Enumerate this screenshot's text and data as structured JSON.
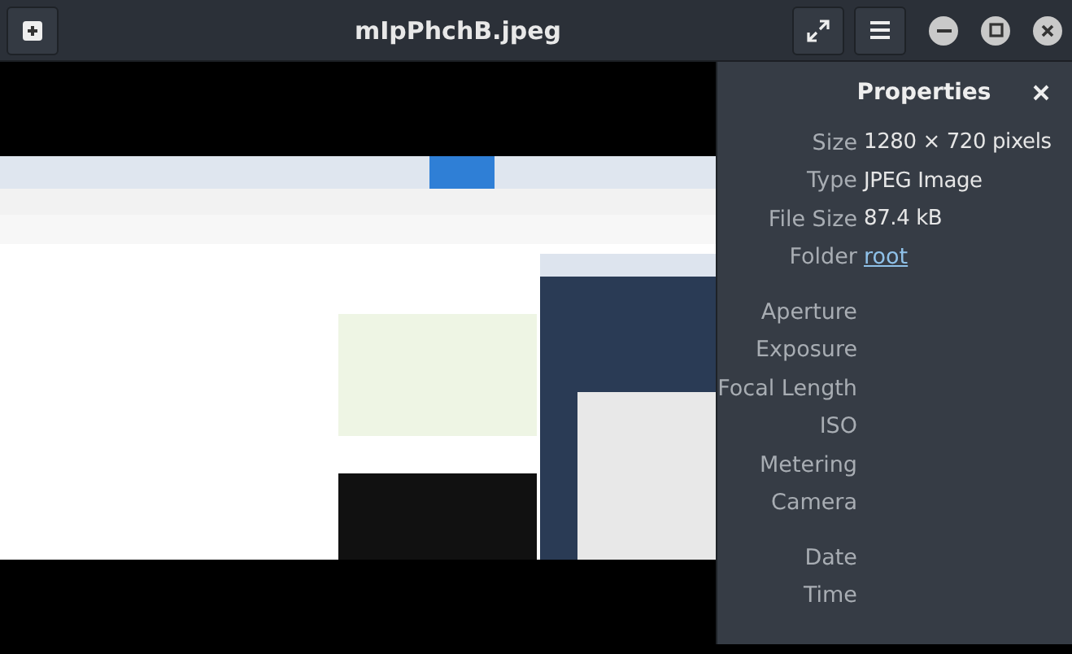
{
  "window": {
    "title": "mIpPhchB.jpeg"
  },
  "properties": {
    "title": "Properties",
    "rows": [
      {
        "label": "Size",
        "value": "1280 × 720 pixels",
        "kind": "text"
      },
      {
        "label": "Type",
        "value": "JPEG Image",
        "kind": "text"
      },
      {
        "label": "File Size",
        "value": "87.4 kB",
        "kind": "text"
      },
      {
        "label": "Folder",
        "value": "root",
        "kind": "link"
      },
      {
        "label": "Aperture",
        "kind": "gap"
      },
      {
        "label": "Exposure",
        "kind": "text"
      },
      {
        "label": "Focal Length",
        "kind": "text"
      },
      {
        "label": "ISO",
        "kind": "text"
      },
      {
        "label": "Metering",
        "kind": "text"
      },
      {
        "label": "Camera",
        "kind": "text"
      },
      {
        "label": "Date",
        "kind": "gap"
      },
      {
        "label": "Time",
        "kind": "text"
      }
    ]
  }
}
